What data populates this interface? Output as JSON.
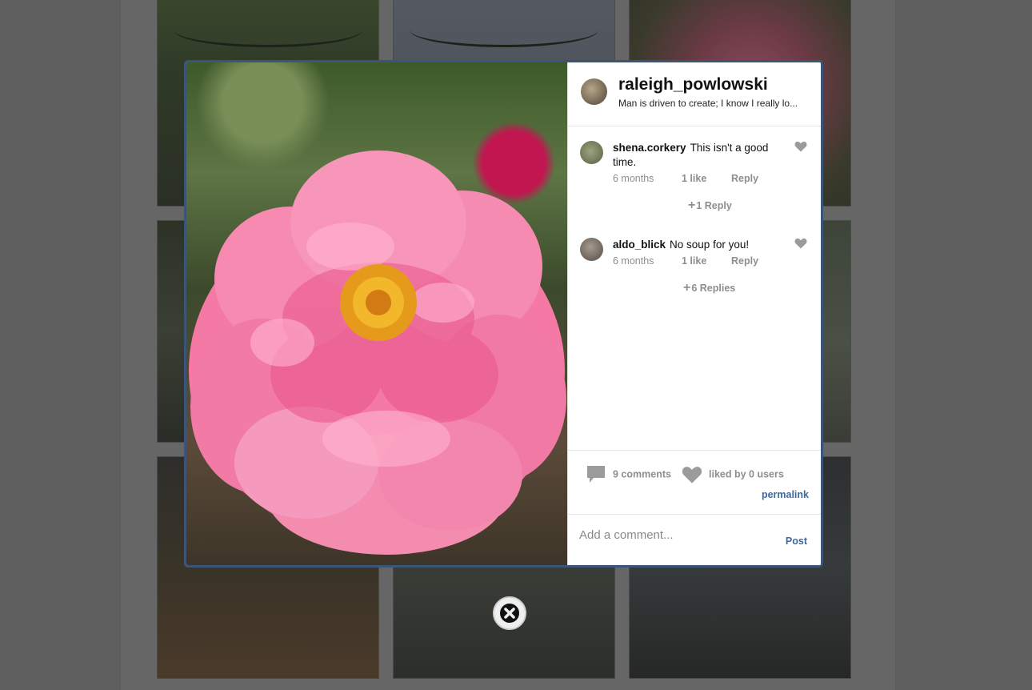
{
  "post": {
    "username": "raleigh_powlowski",
    "bio": "Man is driven to create; I know I really lo..."
  },
  "comments": [
    {
      "author": "shena.corkery",
      "text": "This isn't a good time.",
      "time": "6 months",
      "likes": "1 like",
      "reply_label": "Reply",
      "replies_label": "1 Reply"
    },
    {
      "author": "aldo_blick",
      "text": "No soup for you!",
      "time": "6 months",
      "likes": "1 like",
      "reply_label": "Reply",
      "replies_label": "6 Replies"
    }
  ],
  "stats": {
    "comments_label": "9 comments",
    "likes_label": "liked by 0 users",
    "permalink_label": "permalink"
  },
  "add_comment": {
    "placeholder": "Add a comment...",
    "post_label": "Post"
  },
  "icons": {
    "close": "close-icon",
    "heart": "heart-icon",
    "comment": "comment-icon",
    "plus": "plus-icon"
  },
  "colors": {
    "link": "#3b6a9e",
    "modal_border": "#3b5578",
    "muted_text": "#8e8e8e"
  }
}
